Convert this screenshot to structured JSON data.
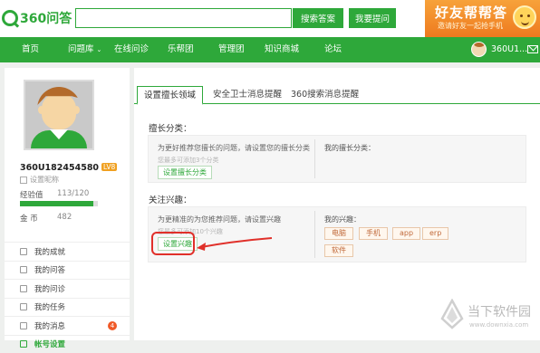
{
  "header": {
    "logo_text": "360问答",
    "search_placeholder": "",
    "search_button": "搜索答案",
    "ask_button": "我要提问",
    "promo_title": "好友帮帮答",
    "promo_sub": "邀请好友一起抢手机"
  },
  "nav": {
    "items": [
      "首页",
      "问题库",
      "在线问诊",
      "乐帮团",
      "管理团",
      "知识商城",
      "论坛"
    ],
    "user": "360U1..."
  },
  "profile": {
    "username": "360U182454580",
    "level": "LV8",
    "set_nickname": "设置昵称",
    "exp_label": "经验值",
    "exp_value": "113/120",
    "exp_progress": 0.94,
    "gold_label": "金  币",
    "gold_value": "482",
    "menu": [
      {
        "label": "我的成就"
      },
      {
        "label": "我的问答"
      },
      {
        "label": "我的问诊"
      },
      {
        "label": "我的任务"
      },
      {
        "label": "我的消息",
        "badge": "4"
      },
      {
        "label": "帐号设置"
      }
    ]
  },
  "tabs": [
    "设置擅长领域",
    "安全卫士消息提醒",
    "360搜索消息提醒"
  ],
  "expertise": {
    "title": "擅长分类：",
    "desc": "为更好推荐您擅长的问题，请设置您的擅长分类",
    "hint": "您最多可添加3个分类",
    "button": "设置擅长分类",
    "my_label": "我的擅长分类："
  },
  "interest": {
    "title": "关注兴趣：",
    "desc": "为更精准的为您推荐问题，请设置兴趣",
    "hint": "您最多可添加10个兴趣",
    "button": "设置兴趣",
    "my_label": "我的兴趣：",
    "tags": [
      "电脑",
      "手机",
      "app",
      "erp",
      "软件"
    ]
  },
  "watermark": {
    "title": "当下软件园",
    "url": "www.downxia.com"
  }
}
